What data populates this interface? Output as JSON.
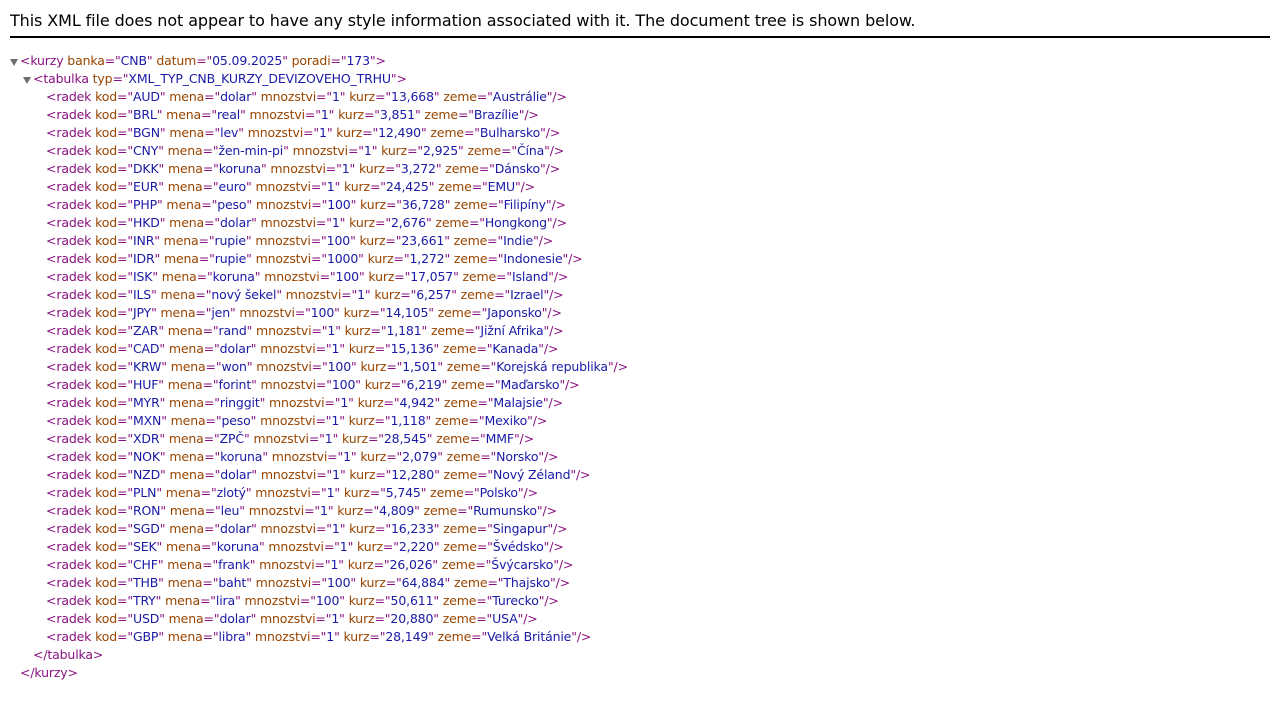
{
  "header_text": "This XML file does not appear to have any style information associated with it. The document tree is shown below.",
  "root": {
    "tag": "kurzy",
    "attrs": [
      {
        "name": "banka",
        "value": "CNB"
      },
      {
        "name": "datum",
        "value": "05.09.2025"
      },
      {
        "name": "poradi",
        "value": "173"
      }
    ]
  },
  "table": {
    "tag": "tabulka",
    "attrs": [
      {
        "name": "typ",
        "value": "XML_TYP_CNB_KURZY_DEVIZOVEHO_TRHU"
      }
    ]
  },
  "row_tag": "radek",
  "row_attr_names": [
    "kod",
    "mena",
    "mnozstvi",
    "kurz",
    "zeme"
  ],
  "rows": [
    [
      "AUD",
      "dolar",
      "1",
      "13,668",
      "Austrálie"
    ],
    [
      "BRL",
      "real",
      "1",
      "3,851",
      "Brazílie"
    ],
    [
      "BGN",
      "lev",
      "1",
      "12,490",
      "Bulharsko"
    ],
    [
      "CNY",
      "žen-min-pi",
      "1",
      "2,925",
      "Čína"
    ],
    [
      "DKK",
      "koruna",
      "1",
      "3,272",
      "Dánsko"
    ],
    [
      "EUR",
      "euro",
      "1",
      "24,425",
      "EMU"
    ],
    [
      "PHP",
      "peso",
      "100",
      "36,728",
      "Filipíny"
    ],
    [
      "HKD",
      "dolar",
      "1",
      "2,676",
      "Hongkong"
    ],
    [
      "INR",
      "rupie",
      "100",
      "23,661",
      "Indie"
    ],
    [
      "IDR",
      "rupie",
      "1000",
      "1,272",
      "Indonesie"
    ],
    [
      "ISK",
      "koruna",
      "100",
      "17,057",
      "Island"
    ],
    [
      "ILS",
      "nový šekel",
      "1",
      "6,257",
      "Izrael"
    ],
    [
      "JPY",
      "jen",
      "100",
      "14,105",
      "Japonsko"
    ],
    [
      "ZAR",
      "rand",
      "1",
      "1,181",
      "Jižní Afrika"
    ],
    [
      "CAD",
      "dolar",
      "1",
      "15,136",
      "Kanada"
    ],
    [
      "KRW",
      "won",
      "100",
      "1,501",
      "Korejská republika"
    ],
    [
      "HUF",
      "forint",
      "100",
      "6,219",
      "Maďarsko"
    ],
    [
      "MYR",
      "ringgit",
      "1",
      "4,942",
      "Malajsie"
    ],
    [
      "MXN",
      "peso",
      "1",
      "1,118",
      "Mexiko"
    ],
    [
      "XDR",
      "ZPČ",
      "1",
      "28,545",
      "MMF"
    ],
    [
      "NOK",
      "koruna",
      "1",
      "2,079",
      "Norsko"
    ],
    [
      "NZD",
      "dolar",
      "1",
      "12,280",
      "Nový Zéland"
    ],
    [
      "PLN",
      "zlotý",
      "1",
      "5,745",
      "Polsko"
    ],
    [
      "RON",
      "leu",
      "1",
      "4,809",
      "Rumunsko"
    ],
    [
      "SGD",
      "dolar",
      "1",
      "16,233",
      "Singapur"
    ],
    [
      "SEK",
      "koruna",
      "1",
      "2,220",
      "Švédsko"
    ],
    [
      "CHF",
      "frank",
      "1",
      "26,026",
      "Švýcarsko"
    ],
    [
      "THB",
      "baht",
      "100",
      "64,884",
      "Thajsko"
    ],
    [
      "TRY",
      "lira",
      "100",
      "50,611",
      "Turecko"
    ],
    [
      "USD",
      "dolar",
      "1",
      "20,880",
      "USA"
    ],
    [
      "GBP",
      "libra",
      "1",
      "28,149",
      "Velká Británie"
    ]
  ],
  "colors": {
    "tag": "#881280",
    "attr_name": "#994500",
    "attr_value": "#1a1aa6",
    "toggle": "#6e6e6e"
  }
}
